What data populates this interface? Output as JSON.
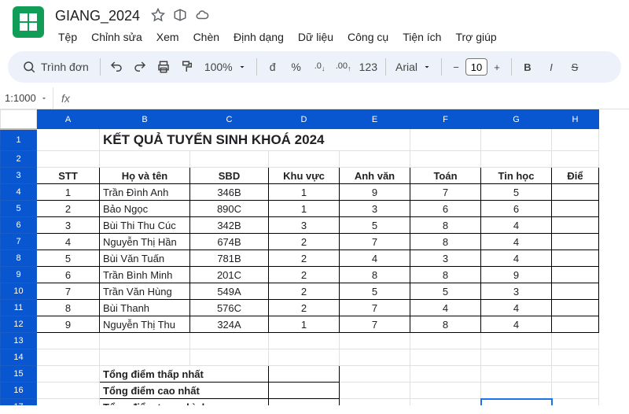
{
  "doc_title": "GIANG_2024",
  "menubar": [
    "Tệp",
    "Chỉnh sửa",
    "Xem",
    "Chèn",
    "Định dạng",
    "Dữ liệu",
    "Công cụ",
    "Tiện ích",
    "Trợ giúp"
  ],
  "toolbar": {
    "search_label": "Trình đơn",
    "zoom": "100%",
    "currency_d": "đ",
    "percent": "%",
    "dec_dec": ".0",
    "dec_inc": ".00",
    "format_123": "123",
    "font_name": "Arial",
    "font_size": "10"
  },
  "name_box": "1:1000",
  "formula_bar": "",
  "columns": [
    "A",
    "B",
    "C",
    "D",
    "E",
    "F",
    "G",
    "H"
  ],
  "sheet_title": "KẾT QUẢ TUYỂN SINH KHOÁ 2024",
  "headers": {
    "stt": "STT",
    "ho_ten": "Họ và tên",
    "sbd": "SBD",
    "khu_vuc": "Khu vực",
    "anh_van": "Anh văn",
    "toan": "Toán",
    "tin_hoc": "Tin học",
    "diem": "Điể"
  },
  "rows": [
    {
      "stt": "1",
      "ho_ten": "Trần Đình Anh",
      "sbd": "346B",
      "kv": "1",
      "av": "9",
      "toan": "7",
      "th": "5"
    },
    {
      "stt": "2",
      "ho_ten": "Bảo Ngọc",
      "sbd": "890C",
      "kv": "1",
      "av": "3",
      "toan": "6",
      "th": "6"
    },
    {
      "stt": "3",
      "ho_ten": "Bùi Thi Thu Cúc",
      "sbd": "342B",
      "kv": "3",
      "av": "5",
      "toan": "8",
      "th": "4"
    },
    {
      "stt": "4",
      "ho_ten": "Nguyễn Thị Hần",
      "sbd": "674B",
      "kv": "2",
      "av": "7",
      "toan": "8",
      "th": "4"
    },
    {
      "stt": "5",
      "ho_ten": "Bùi Văn Tuấn",
      "sbd": "781B",
      "kv": "2",
      "av": "4",
      "toan": "3",
      "th": "4"
    },
    {
      "stt": "6",
      "ho_ten": "Trần Bình Minh",
      "sbd": "201C",
      "kv": "2",
      "av": "8",
      "toan": "8",
      "th": "9"
    },
    {
      "stt": "7",
      "ho_ten": "Trần Văn Hùng",
      "sbd": "549A",
      "kv": "2",
      "av": "5",
      "toan": "5",
      "th": "3"
    },
    {
      "stt": "8",
      "ho_ten": "Bùi Thanh",
      "sbd": "576C",
      "kv": "2",
      "av": "7",
      "toan": "4",
      "th": "4"
    },
    {
      "stt": "9",
      "ho_ten": "Nguyễn Thị Thu",
      "sbd": "324A",
      "kv": "1",
      "av": "7",
      "toan": "8",
      "th": "4"
    }
  ],
  "summary": {
    "low": "Tổng điểm thấp nhất",
    "high": "Tổng điểm cao nhất",
    "avg": "Tổng điểm trung bình"
  },
  "chart_data": {
    "type": "table",
    "title": "KẾT QUẢ TUYỂN SINH KHOÁ 2024",
    "columns": [
      "STT",
      "Họ và tên",
      "SBD",
      "Khu vực",
      "Anh văn",
      "Toán",
      "Tin học"
    ],
    "rows": [
      [
        1,
        "Trần Đình Anh",
        "346B",
        1,
        9,
        7,
        5
      ],
      [
        2,
        "Bảo Ngọc",
        "890C",
        1,
        3,
        6,
        6
      ],
      [
        3,
        "Bùi Thi Thu Cúc",
        "342B",
        3,
        5,
        8,
        4
      ],
      [
        4,
        "Nguyễn Thị Hần",
        "674B",
        2,
        7,
        8,
        4
      ],
      [
        5,
        "Bùi Văn Tuấn",
        "781B",
        2,
        4,
        3,
        4
      ],
      [
        6,
        "Trần Bình Minh",
        "201C",
        2,
        8,
        8,
        9
      ],
      [
        7,
        "Trần Văn Hùng",
        "549A",
        2,
        5,
        5,
        3
      ],
      [
        8,
        "Bùi Thanh",
        "576C",
        2,
        7,
        4,
        4
      ],
      [
        9,
        "Nguyễn Thị Thu",
        "324A",
        1,
        7,
        8,
        4
      ]
    ]
  }
}
